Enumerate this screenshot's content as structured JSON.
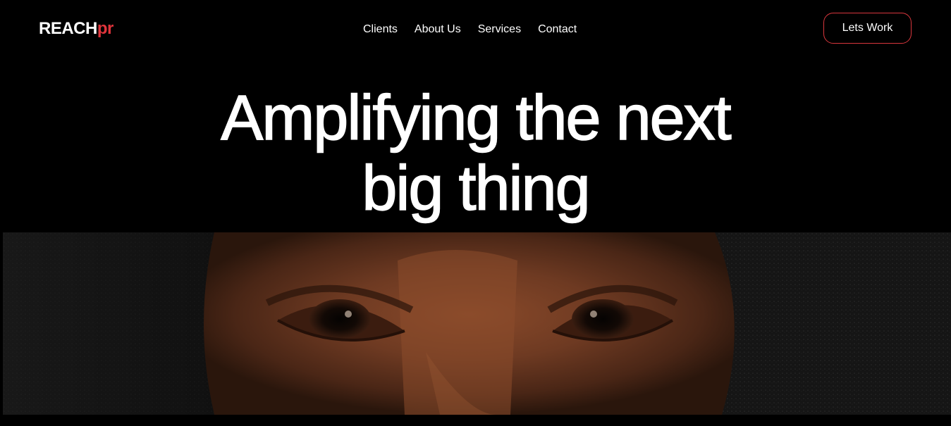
{
  "header": {
    "logo": {
      "main": "REACH",
      "accent": "pr",
      "accent_color": "#e0343b"
    },
    "nav": [
      {
        "label": "Clients"
      },
      {
        "label": "About Us"
      },
      {
        "label": "Services"
      },
      {
        "label": "Contact"
      }
    ],
    "cta_label": "Lets Work",
    "cta_border_color": "#d9373d"
  },
  "hero": {
    "title_line1": "Amplifying the next",
    "title_line2": "big thing"
  },
  "photo": {
    "subject": "close-up of a woman's eyes"
  }
}
